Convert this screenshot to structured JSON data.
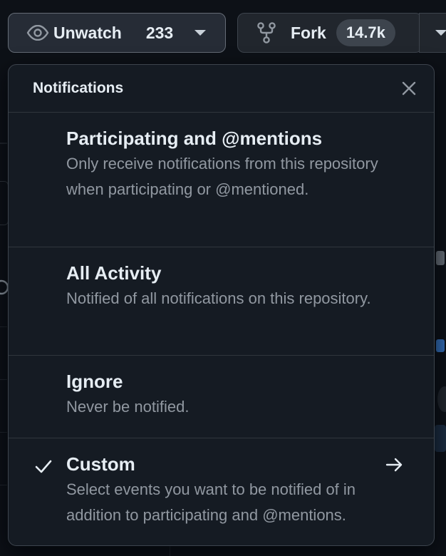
{
  "repo_actions": {
    "watch": {
      "label": "Unwatch",
      "count": "233",
      "icon": "eye-icon"
    },
    "fork": {
      "label": "Fork",
      "count": "14.7k",
      "icon": "repo-forked-icon"
    }
  },
  "notifications_menu": {
    "title": "Notifications",
    "close_icon": "x-icon",
    "options": [
      {
        "title": "Participating and @mentions",
        "description": "Only receive notifications from this repository when participating or @mentioned.",
        "selected": false
      },
      {
        "title": "All Activity",
        "description": "Notified of all notifications on this repository.",
        "selected": false
      },
      {
        "title": "Ignore",
        "description": "Never be notified.",
        "selected": false
      },
      {
        "title": "Custom",
        "description": "Select events you want to be notified of in addition to participating and @mentions.",
        "selected": true,
        "trailing_icon": "arrow-right-icon"
      }
    ]
  },
  "colors": {
    "background": "#0d1117",
    "menu_background": "#151b23",
    "border": "#3d444d",
    "text_primary": "#e6edf3",
    "text_muted": "#9198a1"
  }
}
